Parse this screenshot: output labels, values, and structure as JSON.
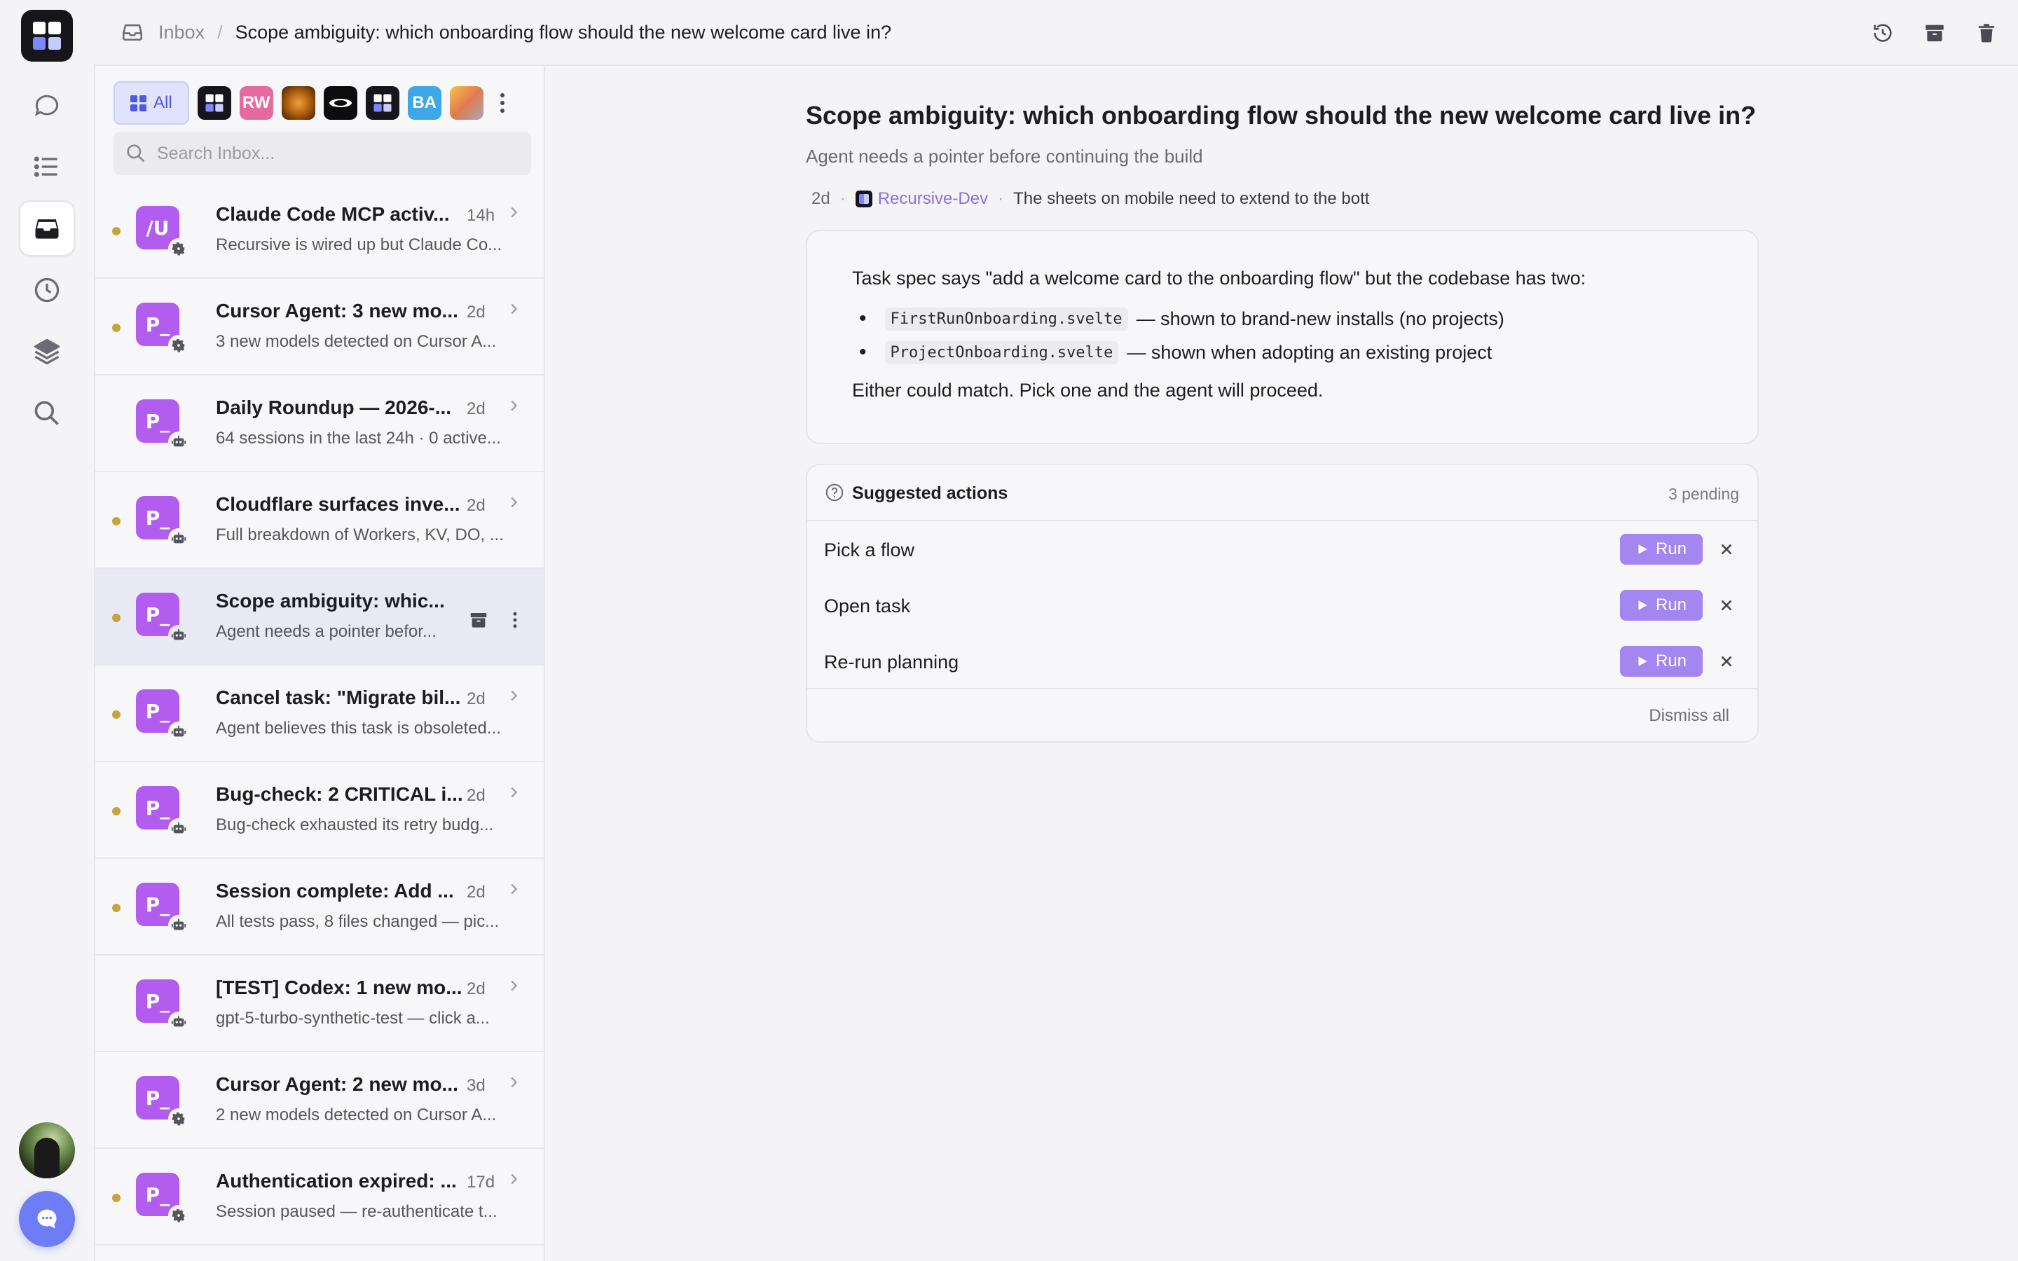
{
  "breadcrumb": {
    "inbox_label": "Inbox",
    "separator": "/",
    "title": "Scope ambiguity: which onboarding flow should the new welcome card live in?"
  },
  "rail": {
    "items": [
      "chat-icon",
      "list-icon",
      "inbox-icon",
      "history-icon",
      "layers-icon",
      "search-icon"
    ],
    "active": "inbox-icon"
  },
  "top_actions": [
    "restore-icon",
    "archive-icon",
    "trash-icon"
  ],
  "filters": {
    "all_label": "All",
    "workspaces": [
      {
        "label": "",
        "style": "dark-logo"
      },
      {
        "label": "RW",
        "color": "#e56a9d"
      },
      {
        "label": "",
        "style": "orange-orb"
      },
      {
        "label": "",
        "style": "eclipse"
      },
      {
        "label": "",
        "style": "dark-logo"
      },
      {
        "label": "BA",
        "color": "#3ea8e6"
      },
      {
        "label": "",
        "style": "multicolor"
      }
    ]
  },
  "search": {
    "placeholder": "Search Inbox..."
  },
  "inbox": [
    {
      "icon": "/U",
      "badge": "gear-icon",
      "unread": true,
      "title": "Claude Code MCP activ...",
      "time": "14h",
      "snippet": "Recursive is wired up but Claude Co..."
    },
    {
      "icon": "P_",
      "badge": "gear-icon",
      "unread": true,
      "title": "Cursor Agent: 3 new mo...",
      "time": "2d",
      "snippet": "3 new models detected on Cursor A..."
    },
    {
      "icon": "P_",
      "badge": "robot-icon",
      "unread": false,
      "title": "Daily Roundup — 2026-...",
      "time": "2d",
      "snippet": "64 sessions in the last 24h · 0 active..."
    },
    {
      "icon": "P_",
      "badge": "robot-icon",
      "unread": true,
      "title": "Cloudflare surfaces inve...",
      "time": "2d",
      "snippet": "Full breakdown of Workers, KV, DO, ..."
    },
    {
      "icon": "P_",
      "badge": "robot-icon",
      "unread": true,
      "selected": true,
      "title": "Scope ambiguity: whic...",
      "time": "",
      "snippet": "Agent needs a pointer befor..."
    },
    {
      "icon": "P_",
      "badge": "robot-icon",
      "unread": true,
      "title": "Cancel task: \"Migrate bil...",
      "time": "2d",
      "snippet": "Agent believes this task is obsoleted..."
    },
    {
      "icon": "P_",
      "badge": "robot-icon",
      "unread": true,
      "title": "Bug-check: 2 CRITICAL i...",
      "time": "2d",
      "snippet": "Bug-check exhausted its retry budg..."
    },
    {
      "icon": "P_",
      "badge": "robot-icon",
      "unread": true,
      "title": "Session complete: Add ...",
      "time": "2d",
      "snippet": "All tests pass, 8 files changed — pic..."
    },
    {
      "icon": "P_",
      "badge": "robot-icon",
      "unread": false,
      "title": "[TEST] Codex: 1 new mo...",
      "time": "2d",
      "snippet": "gpt-5-turbo-synthetic-test — click a..."
    },
    {
      "icon": "P_",
      "badge": "gear-icon",
      "unread": false,
      "title": "Cursor Agent: 2 new mo...",
      "time": "3d",
      "snippet": "2 new models detected on Cursor A..."
    },
    {
      "icon": "P_",
      "badge": "gear-icon",
      "unread": true,
      "title": "Authentication expired: ...",
      "time": "17d",
      "snippet": "Session paused — re-authenticate t..."
    }
  ],
  "detail": {
    "title": "Scope ambiguity: which onboarding flow should the new welcome card live in?",
    "subtitle": "Agent needs a pointer before continuing the build",
    "meta": {
      "age": "2d",
      "project": "Recursive-Dev",
      "excerpt": "The sheets on mobile need to extend to the bott"
    },
    "body": {
      "intro": "Task spec says \"add a welcome card to the onboarding flow\" but the codebase has two:",
      "options": [
        {
          "code": "FirstRunOnboarding.svelte",
          "text": "— shown to brand-new installs (no projects)"
        },
        {
          "code": "ProjectOnboarding.svelte",
          "text": "— shown when adopting an existing project"
        }
      ],
      "outro": "Either could match. Pick one and the agent will proceed."
    },
    "suggested": {
      "heading": "Suggested actions",
      "pending": "3 pending",
      "run_label": "Run",
      "items": [
        "Pick a flow",
        "Open task",
        "Re-run planning"
      ],
      "dismiss_all": "Dismiss all"
    }
  },
  "colors": {
    "accent": "#6e7cf5",
    "item_icon": "#b25cf0",
    "run_button": "#a486f0",
    "unread_dot": "#c9a23c",
    "project_link": "#8b6fe0"
  }
}
